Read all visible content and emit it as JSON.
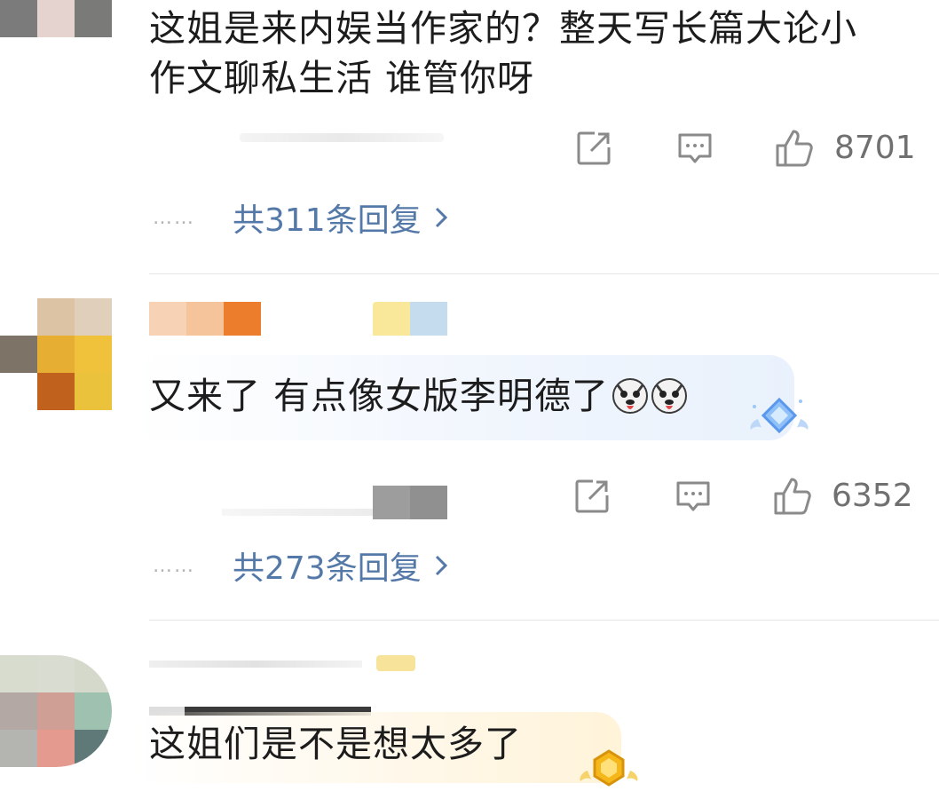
{
  "comments": [
    {
      "text_line1": "这姐是来内娱当作家的？整天写长篇大论小",
      "text_line2": "作文聊私生活 谁管你呀",
      "like_count": "8701",
      "reply_label": "共311条回复",
      "dots": "……"
    },
    {
      "text": "又来了 有点像女版李明德了",
      "emoji_name": "husky-emoji",
      "like_count": "6352",
      "reply_label": "共273条回复",
      "dots": "……"
    },
    {
      "text": "这姐们是不是想太多了"
    }
  ],
  "colors": {
    "reply_link": "#5479a8",
    "icon_gray": "#8a8a8a",
    "text": "#1c1c1c"
  },
  "icons": [
    "share-icon",
    "comment-icon",
    "like-icon",
    "chevron-right-icon",
    "diamond-badge-icon",
    "gold-badge-icon"
  ]
}
